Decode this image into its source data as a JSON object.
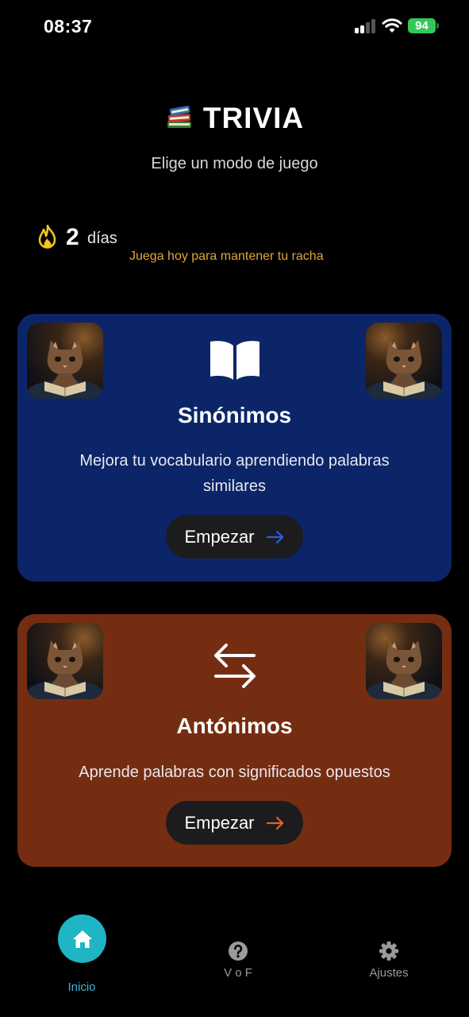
{
  "status_bar": {
    "time": "08:37",
    "battery": "94"
  },
  "header": {
    "title": "TRIVIA",
    "subtitle": "Elige un modo de juego",
    "icon": "books-icon"
  },
  "streak": {
    "count": "2",
    "unit": "días",
    "hint": "Juega hoy para mantener tu racha",
    "icon": "flame-icon"
  },
  "cards": [
    {
      "title": "Sinónimos",
      "description": "Mejora tu vocabulario aprendiendo palabras similares",
      "button": "Empezar",
      "icon": "open-book-icon",
      "color": "#0c2568",
      "arrow_color": "#2a5ee0"
    },
    {
      "title": "Antónimos",
      "description": "Aprende palabras con significados opuestos",
      "button": "Empezar",
      "icon": "swap-arrows-icon",
      "color": "#752d11",
      "arrow_color": "#e0642a"
    }
  ],
  "tabs": [
    {
      "label": "Inicio",
      "icon": "home-icon",
      "active": true,
      "color": "#1fb5c4"
    },
    {
      "label": "V o F",
      "icon": "question-icon",
      "active": false
    },
    {
      "label": "Ajustes",
      "icon": "gear-icon",
      "active": false
    }
  ]
}
